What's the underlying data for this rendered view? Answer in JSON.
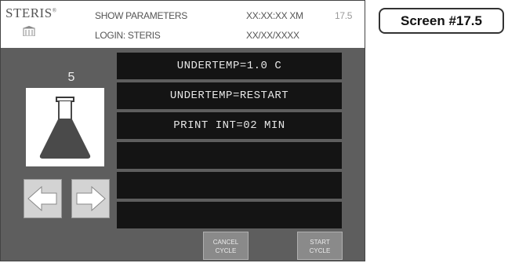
{
  "header": {
    "brand": "STERIS",
    "brand_mark": "®",
    "mode": "SHOW PARAMETERS",
    "login": "LOGIN: STERIS",
    "time": "XX:XX:XX XM",
    "date": "XX/XX/XXXX",
    "screen_number": "17.5"
  },
  "left": {
    "count": "5",
    "load_icon": "flask-icon",
    "nav_prev_icon": "arrow-left-icon",
    "nav_next_icon": "arrow-right-icon"
  },
  "parameters": [
    "UNDERTEMP=1.0 C",
    "UNDERTEMP=RESTART",
    "PRINT INT=02 MIN",
    "",
    "",
    ""
  ],
  "buttons": {
    "cancel_line1": "CANCEL",
    "cancel_line2": "CYCLE",
    "start_line1": "START",
    "start_line2": "CYCLE"
  },
  "screen_label": "Screen #17.5"
}
